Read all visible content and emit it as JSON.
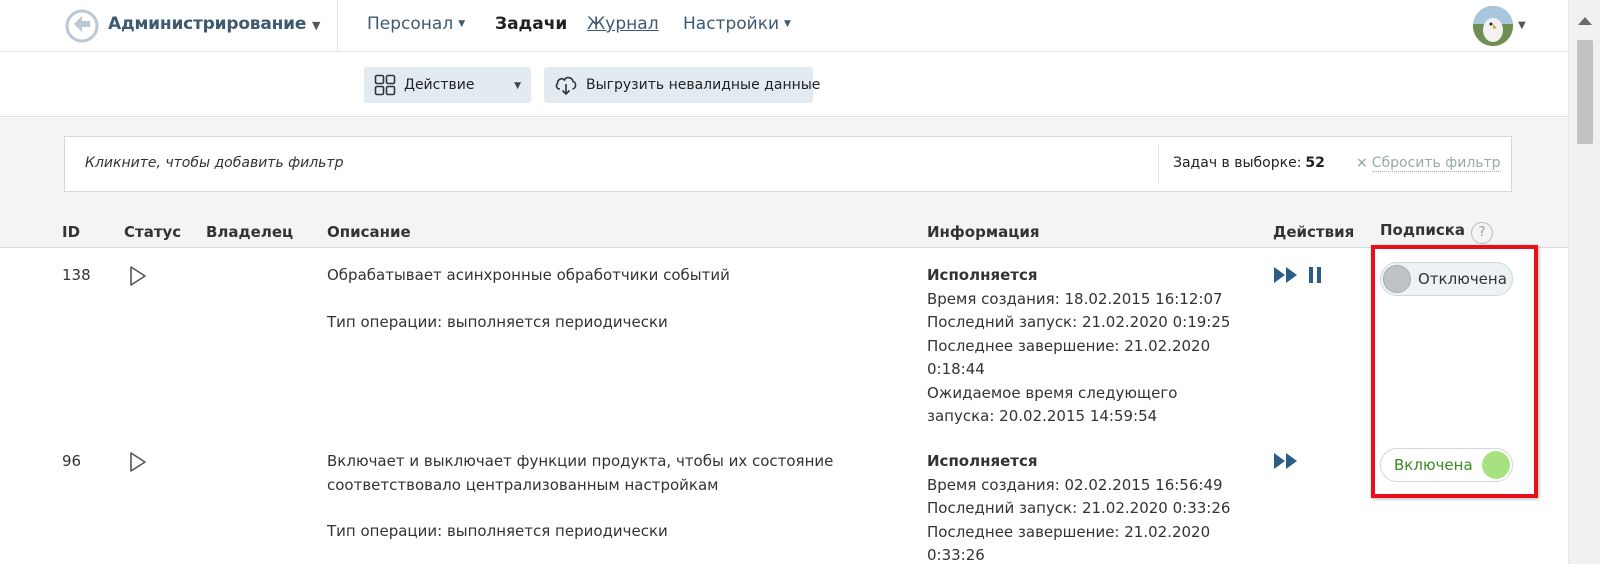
{
  "header": {
    "brand": "Администрирование",
    "nav": [
      {
        "label": "Персонал",
        "has_caret": true
      },
      {
        "label": "Задачи",
        "active": true
      },
      {
        "label": "Журнал",
        "underlined": true
      },
      {
        "label": "Настройки",
        "has_caret": true
      }
    ]
  },
  "toolbar": {
    "action_label": "Действие",
    "export_label": "Выгрузить невалидные данные"
  },
  "filter": {
    "hint": "Кликните, чтобы добавить фильтр",
    "count_label": "Задач в выборке:",
    "count_value": "52",
    "reset_x": "×",
    "reset_label": "Сбросить фильтр"
  },
  "table": {
    "headers": {
      "id": "ID",
      "status": "Статус",
      "owner": "Владелец",
      "description": "Описание",
      "info": "Информация",
      "actions": "Действия",
      "subscription": "Подписка",
      "help": "?"
    },
    "rows": [
      {
        "id": "138",
        "description": "Обрабатывает асинхронные обработчики событий",
        "operation_type": "Тип операции: выполняется периодически",
        "info_status": "Исполняется",
        "info_lines": [
          "Время создания: 18.02.2015 16:12:07",
          "Последний запуск: 21.02.2020 0:19:25",
          "Последнее завершение: 21.02.2020 0:18:44",
          "Ожидаемое время следующего запуска: 20.02.2015 14:59:54"
        ],
        "actions": [
          "fast-forward-icon",
          "pause-icon"
        ],
        "subscription": "Отключена",
        "subscription_on": false
      },
      {
        "id": "96",
        "description": "Включает и выключает функции продукта, чтобы их состояние соответствовало централизованным настройкам",
        "operation_type": "Тип операции: выполняется периодически",
        "info_status": "Исполняется",
        "info_lines": [
          "Время создания: 02.02.2015 16:56:49",
          "Последний запуск: 21.02.2020 0:33:26",
          "Последнее завершение: 21.02.2020 0:33:26"
        ],
        "actions": [
          "fast-forward-icon"
        ],
        "subscription": "Включена",
        "subscription_on": true
      }
    ]
  },
  "colors": {
    "accent": "#3d5a72",
    "action_icon": "#2b5c86",
    "highlight": "#e8101a",
    "toggle_on": "#a6e37e"
  }
}
